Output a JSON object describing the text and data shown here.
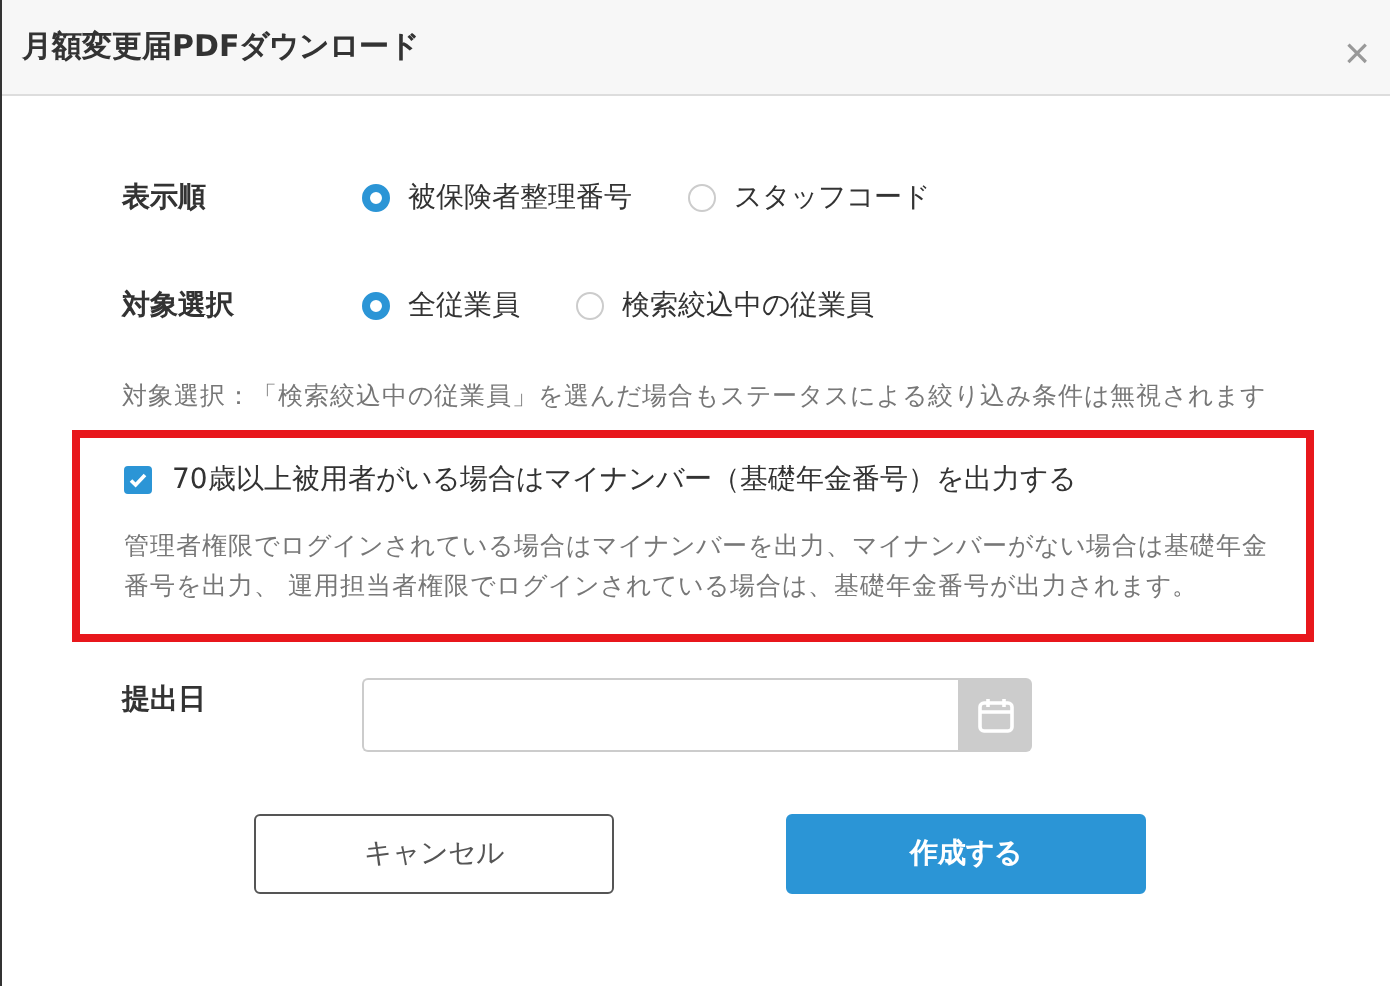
{
  "window": {
    "title": "月額変更届PDFダウンロード",
    "close": "×"
  },
  "rows": [
    {
      "label": "表示順",
      "options": [
        {
          "label": "被保険者整理番号",
          "selected": true
        },
        {
          "label": "スタッフコード",
          "selected": false
        }
      ]
    },
    {
      "label": "対象選択",
      "options": [
        {
          "label": "全従業員",
          "selected": true
        },
        {
          "label": "検索絞込中の従業員",
          "selected": false
        }
      ]
    }
  ],
  "note": "対象選択：「検索絞込中の従業員」を選んだ場合もステータスによる絞り込み条件は無視されます",
  "highlight": {
    "checkbox": {
      "label": "70歳以上被用者がいる場合はマイナンバー（基礎年金番号）を出力する",
      "checked": true
    },
    "description": "管理者権限でログインされている場合はマイナンバーを出力、マイナンバーがない場合は基礎年金番号を出力、 運用担当者権限でログインされている場合は、基礎年金番号が出力されます。"
  },
  "date": {
    "label": "提出日"
  },
  "buttons": [
    {
      "label": "キャンセル",
      "kind": "secondary"
    },
    {
      "label": "作成する",
      "kind": "primary"
    }
  ]
}
